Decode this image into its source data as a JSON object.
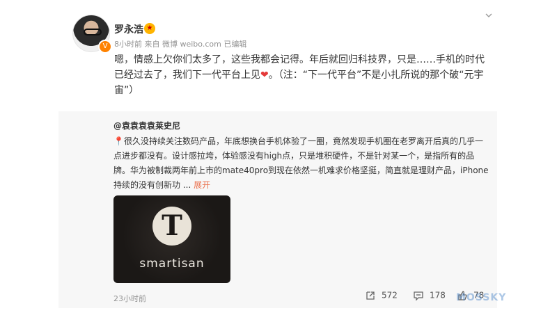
{
  "post": {
    "username": "罗永浩",
    "meta": "8小时前  来自 微博 weibo.com  已编辑",
    "text_part1": "嗯，情感上欠你们太多了，这些我都会记得。年后就回归科技界，只是……手机的时代已经过去了，我们下一代平台上见",
    "heart": "❤",
    "text_part2": "。（注：“下一代平台”不是小扎所说的那个破“元宇宙”）"
  },
  "repost": {
    "user": "@袁袁袁袁莱史尼",
    "pin": "📍",
    "text": "很久没持续关注数码产品，年底想换台手机体验了一圈，竟然发现手机圈在老罗离开后真的几乎一点进步都没有。设计感拉垮，体验感没有high点，只是堆积硬件，不是针对某一个，是指所有的品牌。华为被制裁两年前上市的mate40pro到现在依然一机难求价格坚挺，简直就是理财产品，iPhone持续的没有创新功 ...",
    "expand": "展开",
    "image_logo_letter": "T",
    "image_logo_word": "smartisan",
    "time": "23小时前",
    "reposts": "572",
    "comments": "178",
    "likes": "78"
  },
  "watermark": "MOSSKY",
  "icons": {
    "more": "chevron-down-icon",
    "repost": "share-icon",
    "comment": "comment-icon",
    "like": "thumbs-up-icon"
  }
}
